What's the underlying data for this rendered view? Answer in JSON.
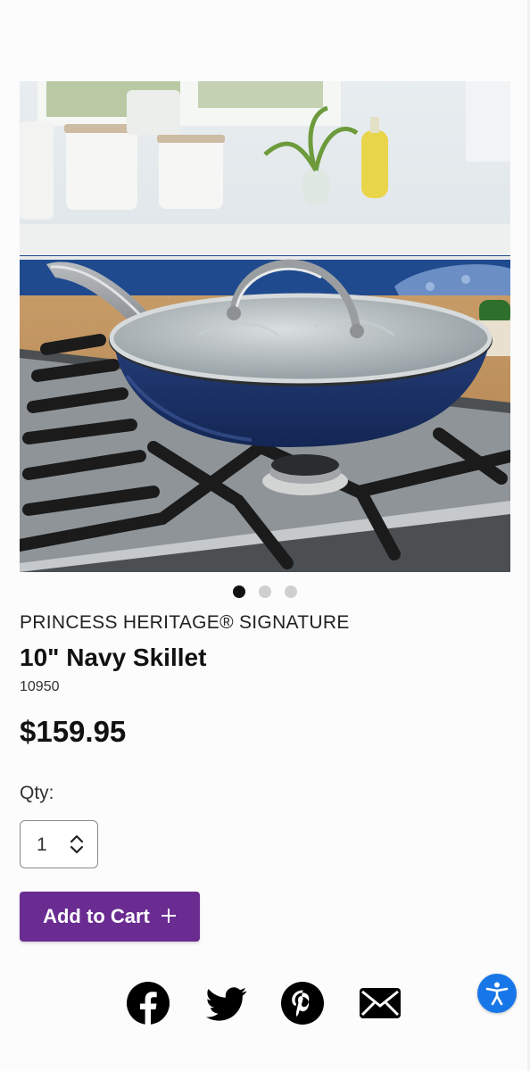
{
  "product": {
    "brand": "PRINCESS HERITAGE® SIGNATURE",
    "name": "10\" Navy Skillet",
    "sku": "10950",
    "price": "$159.95"
  },
  "gallery": {
    "image_count": 3,
    "active_index": 0
  },
  "quantity": {
    "label": "Qty:",
    "value": "1"
  },
  "cart": {
    "label": "Add to Cart",
    "icon": "plus-icon"
  },
  "share": {
    "icons": [
      "facebook-icon",
      "twitter-icon",
      "pinterest-icon",
      "email-icon"
    ]
  },
  "accessibility": {
    "icon": "accessibility-icon"
  },
  "colors": {
    "accent_purple": "#6a2c91",
    "accessibility_blue": "#1877e8",
    "text": "#111111"
  }
}
